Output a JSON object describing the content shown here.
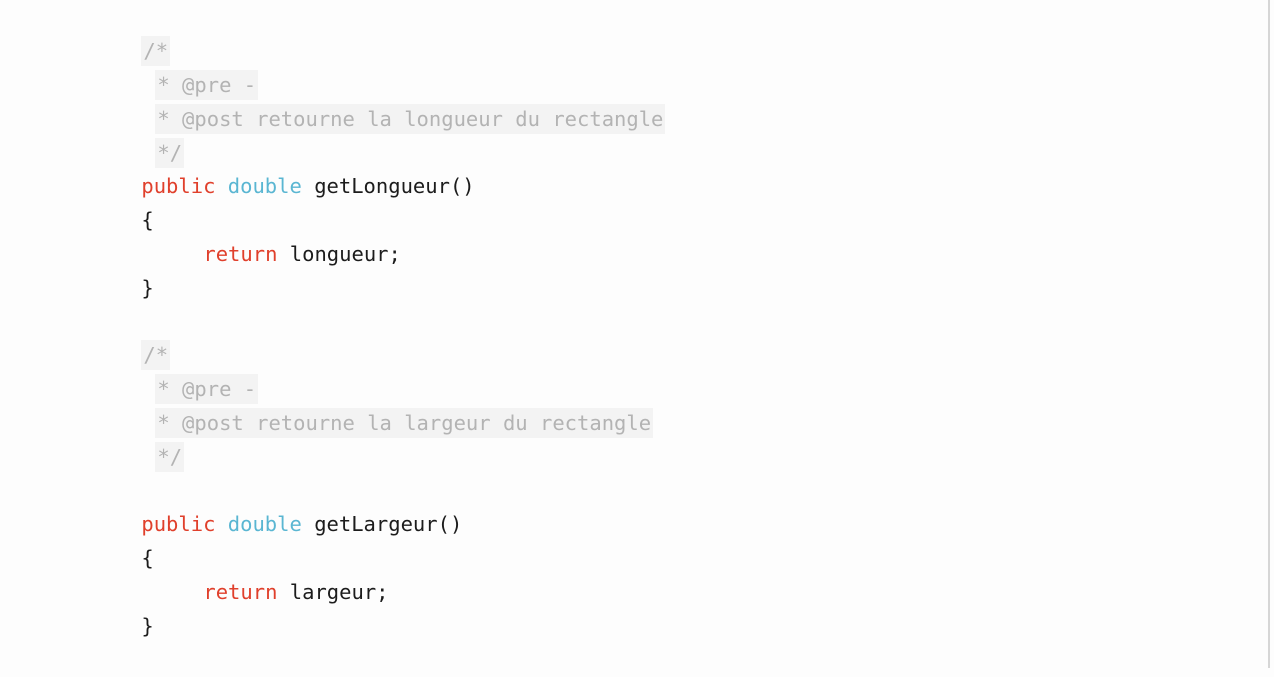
{
  "colors": {
    "background": "#fdfdfd",
    "keyword": "#e0402c",
    "type": "#5ab6d2",
    "comment_text": "#b3b3b3",
    "comment_bg": "#f3f3f3",
    "plain_text": "#1c1c1c"
  },
  "code": {
    "method1": {
      "comment_open": "/*",
      "comment_pre": "* @pre -",
      "comment_post": "* @post retourne la longueur du rectangle",
      "comment_close": "*/",
      "modifier": "public",
      "return_type": "double",
      "signature": "getLongueur()",
      "open_brace": "{",
      "return_keyword": "return",
      "return_value": "longueur;",
      "close_brace": "}"
    },
    "method2": {
      "comment_open": "/*",
      "comment_pre": "* @pre -",
      "comment_post": "* @post retourne la largeur du rectangle",
      "comment_close": "*/",
      "modifier": "public",
      "return_type": "double",
      "signature": "getLargeur()",
      "open_brace": "{",
      "return_keyword": "return",
      "return_value": "largeur;",
      "close_brace": "}"
    }
  }
}
